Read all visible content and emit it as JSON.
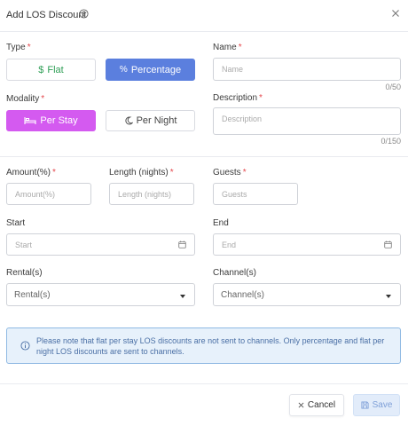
{
  "dialog": {
    "title": "Add LOS Discount"
  },
  "type": {
    "label": "Type",
    "required_mark": "*",
    "flat_label": "Flat",
    "percentage_label": "Percentage",
    "selected": "Percentage"
  },
  "modality": {
    "label": "Modality",
    "required_mark": "*",
    "per_stay_label": "Per Stay",
    "per_night_label": "Per Night",
    "selected": "Per Stay"
  },
  "name": {
    "label": "Name",
    "required_mark": "*",
    "placeholder": "Name",
    "counter": "0/50"
  },
  "description": {
    "label": "Description",
    "required_mark": "*",
    "placeholder": "Description",
    "counter": "0/150"
  },
  "amount": {
    "label": "Amount(%)",
    "required_mark": "*",
    "placeholder": "Amount(%)"
  },
  "length": {
    "label": "Length (nights)",
    "required_mark": "*",
    "placeholder": "Length (nights)"
  },
  "guests": {
    "label": "Guests",
    "required_mark": "*",
    "placeholder": "Guests"
  },
  "start": {
    "label": "Start",
    "placeholder": "Start"
  },
  "end": {
    "label": "End",
    "placeholder": "End"
  },
  "rentals": {
    "label": "Rental(s)",
    "value": "Rental(s)"
  },
  "channels": {
    "label": "Channel(s)",
    "value": "Channel(s)"
  },
  "notice": {
    "text": "Please note that flat per stay LOS discounts are not sent to channels. Only percentage and flat per night LOS discounts are sent to channels."
  },
  "footer": {
    "cancel_label": "Cancel",
    "save_label": "Save"
  },
  "colors": {
    "primary": "#5b7fde",
    "per_stay": "#d45af0",
    "flat_text": "#2e9e55",
    "required": "#e5484d",
    "notice_bg": "#e7f1fb",
    "notice_border": "#8fb9e3"
  }
}
